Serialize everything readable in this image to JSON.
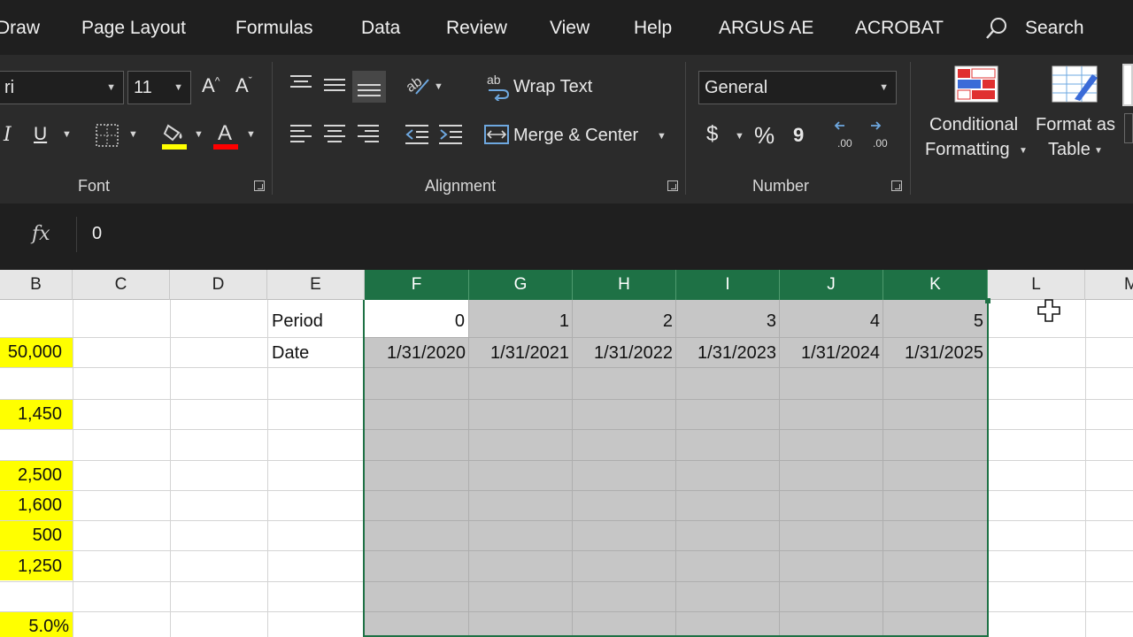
{
  "menu": {
    "tabs": [
      "Draw",
      "Page Layout",
      "Formulas",
      "Data",
      "Review",
      "View",
      "Help",
      "ARGUS AE",
      "ACROBAT"
    ],
    "search_label": "Search"
  },
  "ribbon": {
    "font": {
      "group_label": "Font",
      "font_name": "ri",
      "font_size": "11",
      "grow_icon": "A^",
      "shrink_icon": "Aˇ",
      "italic": "I",
      "underline": "U"
    },
    "alignment": {
      "group_label": "Alignment",
      "wrap_text": "Wrap Text",
      "merge_center": "Merge & Center"
    },
    "number": {
      "group_label": "Number",
      "format": "General",
      "currency": "$",
      "percent": "%",
      "comma": "9",
      "inc_decimal": ".00",
      "dec_decimal": ".00"
    },
    "styles": {
      "conditional_formatting": [
        "Conditional",
        "Formatting"
      ],
      "format_as_table": [
        "Format as",
        "Table"
      ]
    }
  },
  "formula_bar": {
    "fx": "fx",
    "value": "0"
  },
  "columns": [
    {
      "label": "B",
      "selected": false
    },
    {
      "label": "C",
      "selected": false
    },
    {
      "label": "D",
      "selected": false
    },
    {
      "label": "E",
      "selected": false
    },
    {
      "label": "F",
      "selected": true
    },
    {
      "label": "G",
      "selected": true
    },
    {
      "label": "H",
      "selected": true
    },
    {
      "label": "I",
      "selected": true
    },
    {
      "label": "J",
      "selected": true
    },
    {
      "label": "K",
      "selected": true
    },
    {
      "label": "L",
      "selected": false
    },
    {
      "label": "M",
      "selected": false
    }
  ],
  "sheet": {
    "row_labels": {
      "period": "Period",
      "date": "Date"
    },
    "periods": [
      "0",
      "1",
      "2",
      "3",
      "4",
      "5"
    ],
    "dates": [
      "1/31/2020",
      "1/31/2021",
      "1/31/2022",
      "1/31/2023",
      "1/31/2024",
      "1/31/2025"
    ],
    "col_b_values": [
      "50,000",
      "1,450",
      "2,500",
      "1,600",
      "500",
      "1,250",
      "5.0%"
    ]
  },
  "colors": {
    "selection_accent": "#1e7145",
    "input_highlight": "#ffff00",
    "ribbon_bg": "#2b2b2b"
  }
}
